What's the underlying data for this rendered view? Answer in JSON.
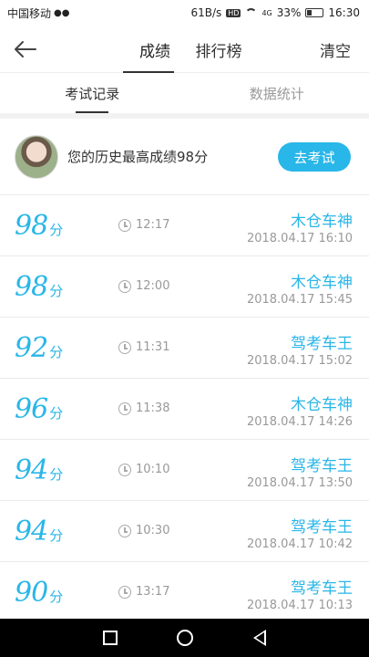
{
  "status_bar": {
    "carrier": "中国移动",
    "speed": "61B/s",
    "network": "4G",
    "battery": "33%",
    "time": "16:30"
  },
  "header": {
    "tabs": [
      "成绩",
      "排行榜"
    ],
    "clear_label": "清空"
  },
  "subtabs": [
    "考试记录",
    "数据统计"
  ],
  "best": {
    "text": "您的历史最高成绩98分",
    "button_label": "去考试"
  },
  "records": [
    {
      "score": "98",
      "unit": "分",
      "duration": "12:17",
      "title": "木仓车神",
      "date": "2018.04.17  16:10"
    },
    {
      "score": "98",
      "unit": "分",
      "duration": "12:00",
      "title": "木仓车神",
      "date": "2018.04.17  15:45"
    },
    {
      "score": "92",
      "unit": "分",
      "duration": "11:31",
      "title": "驾考车王",
      "date": "2018.04.17  15:02"
    },
    {
      "score": "96",
      "unit": "分",
      "duration": "11:38",
      "title": "木仓车神",
      "date": "2018.04.17  14:26"
    },
    {
      "score": "94",
      "unit": "分",
      "duration": "10:10",
      "title": "驾考车王",
      "date": "2018.04.17  13:50"
    },
    {
      "score": "94",
      "unit": "分",
      "duration": "10:30",
      "title": "驾考车王",
      "date": "2018.04.17  10:42"
    },
    {
      "score": "90",
      "unit": "分",
      "duration": "13:17",
      "title": "驾考车王",
      "date": "2018.04.17  10:13"
    }
  ],
  "colors": {
    "accent": "#29b6e8"
  },
  "icons": {
    "back": "arrow-left-icon",
    "clock": "clock-icon"
  }
}
